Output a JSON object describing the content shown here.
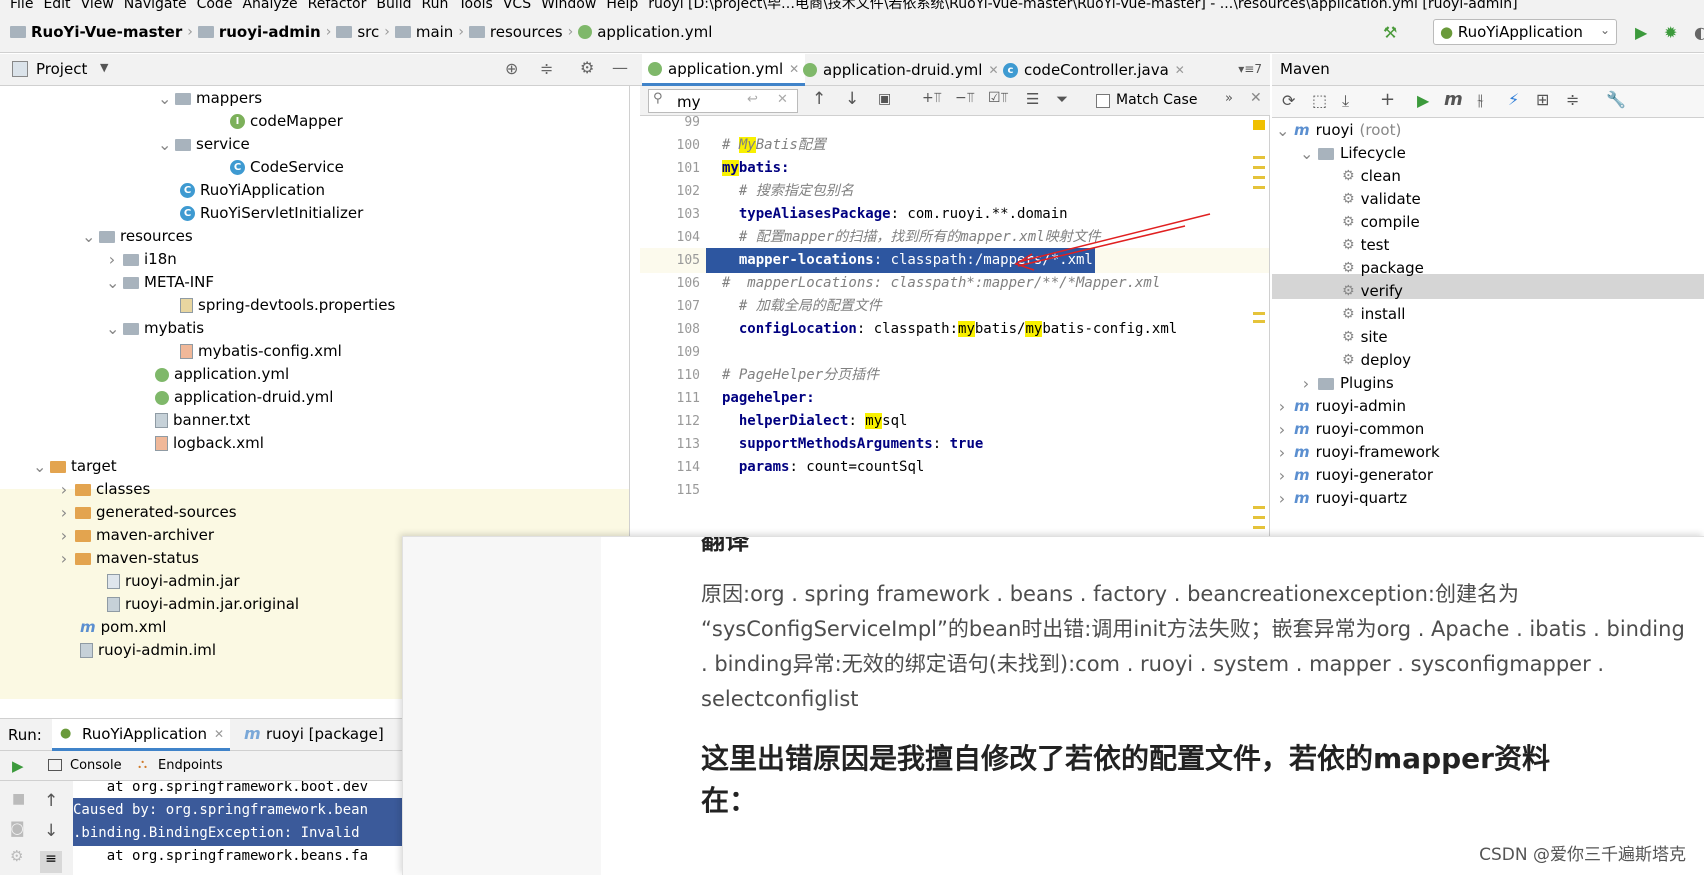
{
  "menu": [
    "File",
    "Edit",
    "View",
    "Navigate",
    "Code",
    "Analyze",
    "Refactor",
    "Build",
    "Run",
    "Tools",
    "VCS",
    "Window",
    "Help",
    "ruoyi [D:\\project\\毕…电商\\技术文件\\若依系统\\RuoYi-Vue-master\\RuoYi-Vue-master] - ...\\resources\\application.yml [ruoyi-admin]"
  ],
  "breadcrumb": [
    "RuoYi-Vue-master",
    "ruoyi-admin",
    "src",
    "main",
    "resources",
    "application.yml"
  ],
  "run_config": "RuoYiApplication",
  "project_header": "Project",
  "tree": [
    {
      "label": "mappers",
      "indent": 180,
      "icon": "folder",
      "chev": "v"
    },
    {
      "label": "codeMapper",
      "indent": 230,
      "icon": "interface"
    },
    {
      "label": "service",
      "indent": 180,
      "icon": "folder",
      "chev": "v"
    },
    {
      "label": "CodeService",
      "indent": 230,
      "icon": "class"
    },
    {
      "label": "RuoYiApplication",
      "indent": 180,
      "icon": "spring-class"
    },
    {
      "label": "RuoYiServletInitializer",
      "indent": 180,
      "icon": "class"
    },
    {
      "label": "resources",
      "indent": 104,
      "icon": "folder",
      "chev": "v"
    },
    {
      "label": "i18n",
      "indent": 128,
      "icon": "folder",
      "chev": ">"
    },
    {
      "label": "META-INF",
      "indent": 128,
      "icon": "folder",
      "chev": "v"
    },
    {
      "label": "spring-devtools.properties",
      "indent": 180,
      "icon": "properties"
    },
    {
      "label": "mybatis",
      "indent": 128,
      "icon": "folder",
      "chev": "v"
    },
    {
      "label": "mybatis-config.xml",
      "indent": 180,
      "icon": "xml"
    },
    {
      "label": "application.yml",
      "indent": 155,
      "icon": "yml"
    },
    {
      "label": "application-druid.yml",
      "indent": 155,
      "icon": "yml"
    },
    {
      "label": "banner.txt",
      "indent": 155,
      "icon": "file"
    },
    {
      "label": "logback.xml",
      "indent": 155,
      "icon": "xml"
    },
    {
      "label": "target",
      "indent": 55,
      "icon": "folder-orange",
      "chev": "v"
    },
    {
      "label": "classes",
      "indent": 80,
      "icon": "folder-orange",
      "chev": ">"
    },
    {
      "label": "generated-sources",
      "indent": 80,
      "icon": "folder-orange",
      "chev": ">"
    },
    {
      "label": "maven-archiver",
      "indent": 80,
      "icon": "folder-orange",
      "chev": ">"
    },
    {
      "label": "maven-status",
      "indent": 80,
      "icon": "folder-orange",
      "chev": ">"
    },
    {
      "label": "ruoyi-admin.jar",
      "indent": 107,
      "icon": "jar"
    },
    {
      "label": "ruoyi-admin.jar.original",
      "indent": 107,
      "icon": "file"
    },
    {
      "label": "pom.xml",
      "indent": 80,
      "icon": "maven"
    },
    {
      "label": "ruoyi-admin.iml",
      "indent": 80,
      "icon": "file"
    }
  ],
  "tabs": [
    "application.yml",
    "application-druid.yml",
    "codeController.java"
  ],
  "tab_more": "▾≡7",
  "search": {
    "value": "my",
    "match_case": "Match Case"
  },
  "code_lines": [
    {
      "n": "99",
      "t": ""
    },
    {
      "n": "100",
      "t": "# MyBatis配置",
      "type": "comment"
    },
    {
      "n": "101",
      "t": "mybatis:",
      "type": "key"
    },
    {
      "n": "102",
      "t": "  # 搜索指定包别名",
      "type": "comment"
    },
    {
      "n": "103",
      "t": "  typeAliasesPackage: com.ruoyi.**.domain",
      "type": "kv"
    },
    {
      "n": "104",
      "t": "  # 配置mapper的扫描，找到所有的mapper.xml映射文件",
      "type": "comment"
    },
    {
      "n": "105",
      "t": "  mapper-locations: classpath:/mappers/*.xml",
      "type": "selected"
    },
    {
      "n": "106",
      "t": "#  mapperLocations: classpath*:mapper/**/*Mapper.xml",
      "type": "comment"
    },
    {
      "n": "107",
      "t": "  # 加载全局的配置文件",
      "type": "comment"
    },
    {
      "n": "108",
      "t": "  configLocation: classpath:mybatis/mybatis-config.xml",
      "type": "kv"
    },
    {
      "n": "109",
      "t": ""
    },
    {
      "n": "110",
      "t": "# PageHelper分页插件",
      "type": "comment"
    },
    {
      "n": "111",
      "t": "pagehelper:",
      "type": "key"
    },
    {
      "n": "112",
      "t": "  helperDialect: mysql",
      "type": "kv"
    },
    {
      "n": "113",
      "t": "  supportMethodsArguments: true",
      "type": "kvb"
    },
    {
      "n": "114",
      "t": "  params: count=countSql",
      "type": "kv"
    },
    {
      "n": "115",
      "t": ""
    }
  ],
  "maven": {
    "header": "Maven",
    "root": "ruoyi",
    "root_suffix": "(root)",
    "lifecycle": "Lifecycle",
    "goals": [
      "clean",
      "validate",
      "compile",
      "test",
      "package",
      "verify",
      "install",
      "site",
      "deploy"
    ],
    "plugins": "Plugins",
    "modules": [
      "ruoyi-admin",
      "ruoyi-common",
      "ruoyi-framework",
      "ruoyi-generator",
      "ruoyi-quartz"
    ]
  },
  "run": {
    "label": "Run:",
    "tab1": "RuoYiApplication",
    "tab2": "ruoyi [package]",
    "console": "Console",
    "endpoints": "Endpoints",
    "lines": [
      "    at org.springframework.boot.dev",
      "Caused by: org.springframework.bean",
      ".binding.BindingException: Invalid",
      "    at org.springframework.beans.fa"
    ]
  },
  "overlay": {
    "heading_partial": "翻译",
    "para": [
      "原因:org . spring framework . beans . factory . beancreationexception:创建名为",
      "“sysConfigServiceImpl”的bean时出错:调用init方法失败；嵌套异常为org . Apache . ibatis . binding",
      ". binding异常:无效的绑定语句(未找到):com . ruoyi . system . mapper . sysconfigmapper .",
      "selectconfiglist"
    ],
    "heading": [
      "这里出错原因是我擅自修改了若依的配置文件，若依的mapper资料",
      "在："
    ],
    "watermark": "CSDN @爱你三千遍斯塔克"
  }
}
